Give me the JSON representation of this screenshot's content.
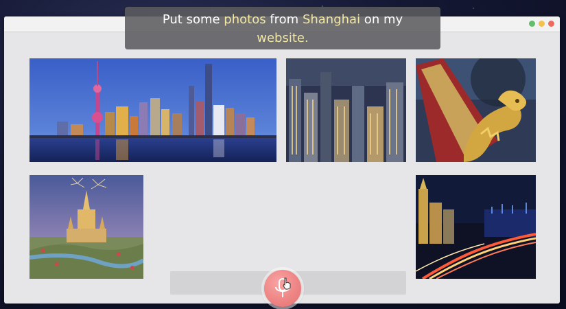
{
  "caption": {
    "parts": [
      "Put some ",
      "photos",
      " from ",
      "Shanghai",
      " on my",
      "website."
    ],
    "highlight_color": "#f1e6a2"
  },
  "gallery": {
    "photos": [
      {
        "name": "shanghai-skyline-photo",
        "subject": "Pudong skyline at dusk"
      },
      {
        "name": "shanghai-night-towers-photo",
        "subject": "Night skyscrapers"
      },
      {
        "name": "golden-dragon-photo",
        "subject": "Golden dragon figurehead"
      },
      {
        "name": "disney-castle-photo",
        "subject": "Shanghai Disneyland castle with fireworks"
      },
      {
        "name": "bund-light-trails-photo",
        "subject": "The Bund with traffic light trails"
      }
    ]
  },
  "input": {
    "value": "",
    "placeholder": ""
  },
  "mic": {
    "icon": "microphone-icon",
    "color": "#ee8585"
  },
  "window_controls": {
    "colors": [
      "#5fbf6a",
      "#f4c04e",
      "#ee6a5f"
    ]
  }
}
